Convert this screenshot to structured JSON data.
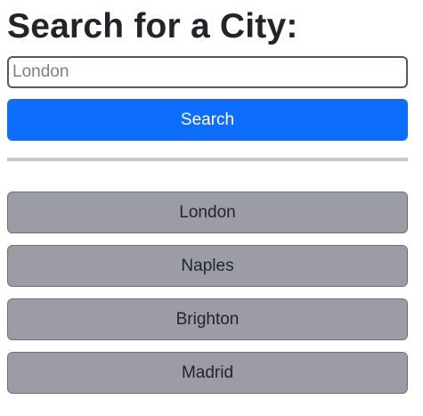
{
  "page": {
    "title": "Search for a City:"
  },
  "search": {
    "placeholder": "London",
    "value": "",
    "button_label": "Search"
  },
  "cities": [
    {
      "label": "London"
    },
    {
      "label": "Naples"
    },
    {
      "label": "Brighton"
    },
    {
      "label": "Madrid"
    }
  ],
  "colors": {
    "primary": "#0d6efd",
    "city_button_bg": "#9c9ca6",
    "divider": "#c8c8c8",
    "text": "#212529"
  }
}
